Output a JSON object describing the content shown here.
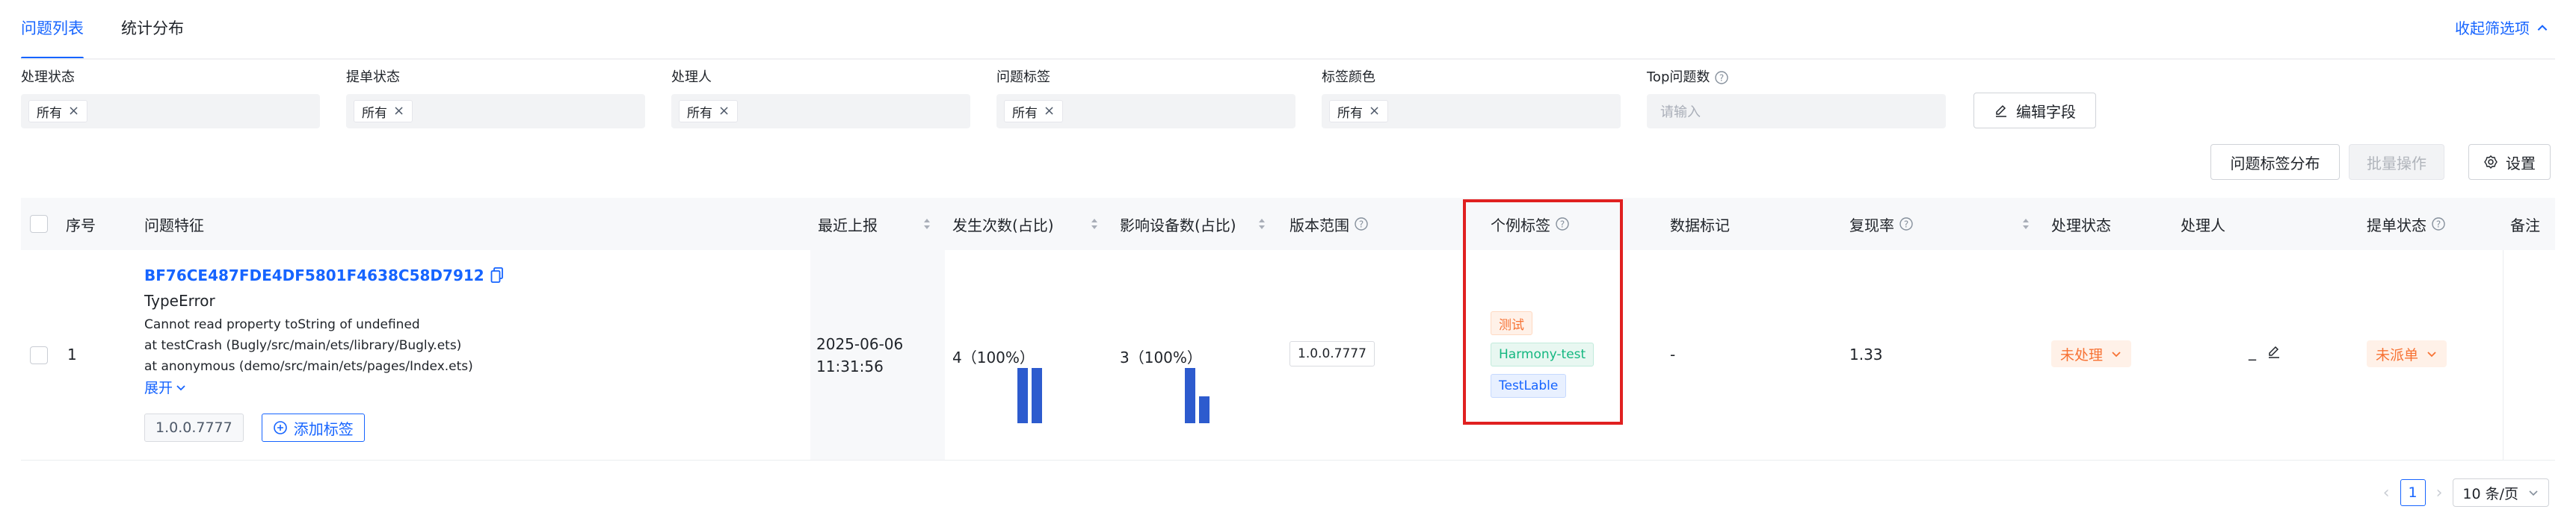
{
  "tabs": [
    {
      "label": "问题列表",
      "active": true
    },
    {
      "label": "统计分布",
      "active": false
    }
  ],
  "collapse_link": "收起筛选项",
  "filters": [
    {
      "label": "处理状态",
      "chip": "所有"
    },
    {
      "label": "提单状态",
      "chip": "所有"
    },
    {
      "label": "处理人",
      "chip": "所有"
    },
    {
      "label": "问题标签",
      "chip": "所有"
    },
    {
      "label": "标签颜色",
      "chip": "所有"
    },
    {
      "label": "Top问题数",
      "placeholder": "请输入"
    }
  ],
  "buttons": {
    "edit_fields": "编辑字段",
    "tag_distribution": "问题标签分布",
    "batch_ops": "批量操作",
    "settings": "设置"
  },
  "columns": {
    "index": "序号",
    "feature": "问题特征",
    "last_report": "最近上报",
    "occurrences": "发生次数(占比)",
    "devices": "影响设备数(占比)",
    "version_range": "版本范围",
    "case_tags": "个例标签",
    "data_mark": "数据标记",
    "repro_rate": "复现率",
    "handle_status": "处理状态",
    "handler": "处理人",
    "ticket_status": "提单状态",
    "remark": "备注"
  },
  "rows": [
    {
      "index": "1",
      "hash": "BF76CE487FDE4DF5801F4638C58D7912",
      "error_type": "TypeError",
      "stack": [
        "Cannot read property toString of undefined",
        "at testCrash (Bugly/src/main/ets/library/Bugly.ets)",
        "at anonymous (demo/src/main/ets/pages/Index.ets)"
      ],
      "expand": "展开",
      "version_tag": "1.0.0.7777",
      "add_tag": "添加标签",
      "last_report_date": "2025-06-06",
      "last_report_time": "11:31:56",
      "occurrences": "4（100%）",
      "devices": "3（100%）",
      "version_range": "1.0.0.7777",
      "case_tags": [
        "测试",
        "Harmony-test",
        "TestLable"
      ],
      "data_mark": "-",
      "repro_rate": "1.33",
      "handle_status": "未处理",
      "handler": "_",
      "ticket_status": "未派单"
    }
  ],
  "pagination": {
    "current": "1",
    "page_size": "10 条/页"
  },
  "colors": {
    "accent": "#1664ff",
    "status_orange": "#f77234",
    "tag_green": "#14b780",
    "highlight": "#e02020",
    "bar": "#2d5bce"
  }
}
